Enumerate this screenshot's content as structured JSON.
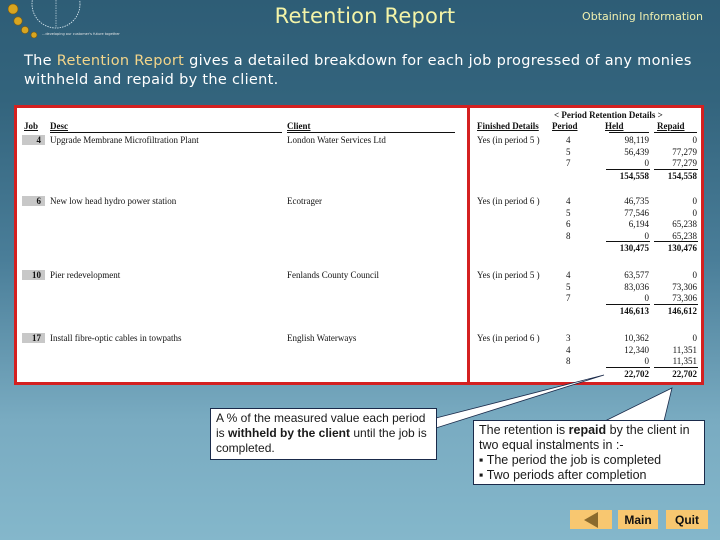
{
  "header": {
    "title": "Retention Report",
    "section": "Obtaining Information",
    "tagline": "...developing our customer's future together",
    "logo_icon": "globe-with-coins-logo"
  },
  "intro": {
    "prefix": "The ",
    "highlight": "Retention Report",
    "suffix": " gives a detailed breakdown for each job progressed of any monies withheld and repaid by the client."
  },
  "report": {
    "group_header": "<   Period Retention Details   >",
    "columns": {
      "job": "Job",
      "desc": "Desc",
      "client": "Client",
      "finished": "Finished Details",
      "period": "Period",
      "held": "Held",
      "repaid": "Repaid"
    },
    "jobs": [
      {
        "job": "4",
        "desc": "Upgrade Membrane Microfiltration Plant",
        "client": "London Water Services Ltd",
        "finished": "Yes (in period 5 )",
        "periods": [
          {
            "period": "4",
            "held": "98,119",
            "repaid": "0"
          },
          {
            "period": "5",
            "held": "56,439",
            "repaid": "77,279"
          },
          {
            "period": "7",
            "held": "0",
            "repaid": "77,279"
          }
        ],
        "total_held": "154,558",
        "total_repaid": "154,558"
      },
      {
        "job": "6",
        "desc": "New low head hydro power station",
        "client": "Ecotrager",
        "finished": "Yes (in period 6 )",
        "periods": [
          {
            "period": "4",
            "held": "46,735",
            "repaid": "0"
          },
          {
            "period": "5",
            "held": "77,546",
            "repaid": "0"
          },
          {
            "period": "6",
            "held": "6,194",
            "repaid": "65,238"
          },
          {
            "period": "8",
            "held": "0",
            "repaid": "65,238"
          }
        ],
        "total_held": "130,475",
        "total_repaid": "130,476"
      },
      {
        "job": "10",
        "desc": "Pier redevelopment",
        "client": "Fenlands County Council",
        "finished": "Yes (in period 5 )",
        "periods": [
          {
            "period": "4",
            "held": "63,577",
            "repaid": "0"
          },
          {
            "period": "5",
            "held": "83,036",
            "repaid": "73,306"
          },
          {
            "period": "7",
            "held": "0",
            "repaid": "73,306"
          }
        ],
        "total_held": "146,613",
        "total_repaid": "146,612"
      },
      {
        "job": "17",
        "desc": "Install fibre-optic cables in towpaths",
        "client": "English Waterways",
        "finished": "Yes (in period 6 )",
        "periods": [
          {
            "period": "3",
            "held": "10,362",
            "repaid": "0"
          },
          {
            "period": "4",
            "held": "12,340",
            "repaid": "11,351"
          },
          {
            "period": "8",
            "held": "0",
            "repaid": "11,351"
          }
        ],
        "total_held": "22,702",
        "total_repaid": "22,702"
      }
    ]
  },
  "callouts": {
    "withheld": {
      "pre": "A % of the measured value each period is ",
      "bold": "withheld by the client",
      "post": " until the job is completed."
    },
    "repaid": {
      "pre": "The retention is ",
      "bold": "repaid",
      "post": " by the client in two equal instalments in :-",
      "bullets": [
        "The period the job is completed",
        "Two periods after completion"
      ]
    }
  },
  "nav": {
    "back_icon": "back-arrow-icon",
    "main_label": "Main",
    "quit_label": "Quit"
  },
  "colors": {
    "title": "#f4f4a8",
    "highlight": "#f3d58a",
    "frame_red": "#d42020",
    "button": "#f8c770"
  }
}
